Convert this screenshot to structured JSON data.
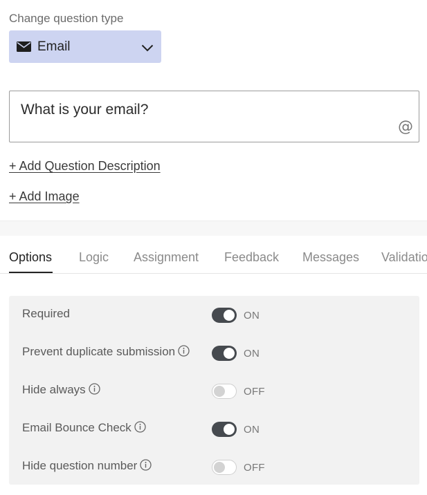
{
  "question_type": {
    "label": "Change question type",
    "selected": "Email",
    "icon": "envelope-icon"
  },
  "question": {
    "text": "What is your email?",
    "icon_glyph": "@"
  },
  "links": {
    "add_description": "+ Add Question Description",
    "add_image": "+ Add Image"
  },
  "tabs": [
    {
      "label": "Options",
      "active": true
    },
    {
      "label": "Logic",
      "active": false
    },
    {
      "label": "Assignment",
      "active": false
    },
    {
      "label": "Feedback",
      "active": false
    },
    {
      "label": "Messages",
      "active": false
    },
    {
      "label": "Validation",
      "active": false
    }
  ],
  "options": [
    {
      "label": "Required",
      "info": false,
      "enabled": true,
      "state": "ON"
    },
    {
      "label": "Prevent duplicate submission",
      "info": true,
      "enabled": true,
      "state": "ON"
    },
    {
      "label": "Hide always",
      "info": true,
      "enabled": false,
      "state": "OFF"
    },
    {
      "label": "Email Bounce Check",
      "info": true,
      "enabled": true,
      "state": "ON"
    },
    {
      "label": "Hide question number",
      "info": true,
      "enabled": false,
      "state": "OFF"
    }
  ],
  "colors": {
    "select_bg": "#cdd4f1",
    "toggle_on": "#464a4f",
    "panel_bg": "#f2f2f2"
  }
}
